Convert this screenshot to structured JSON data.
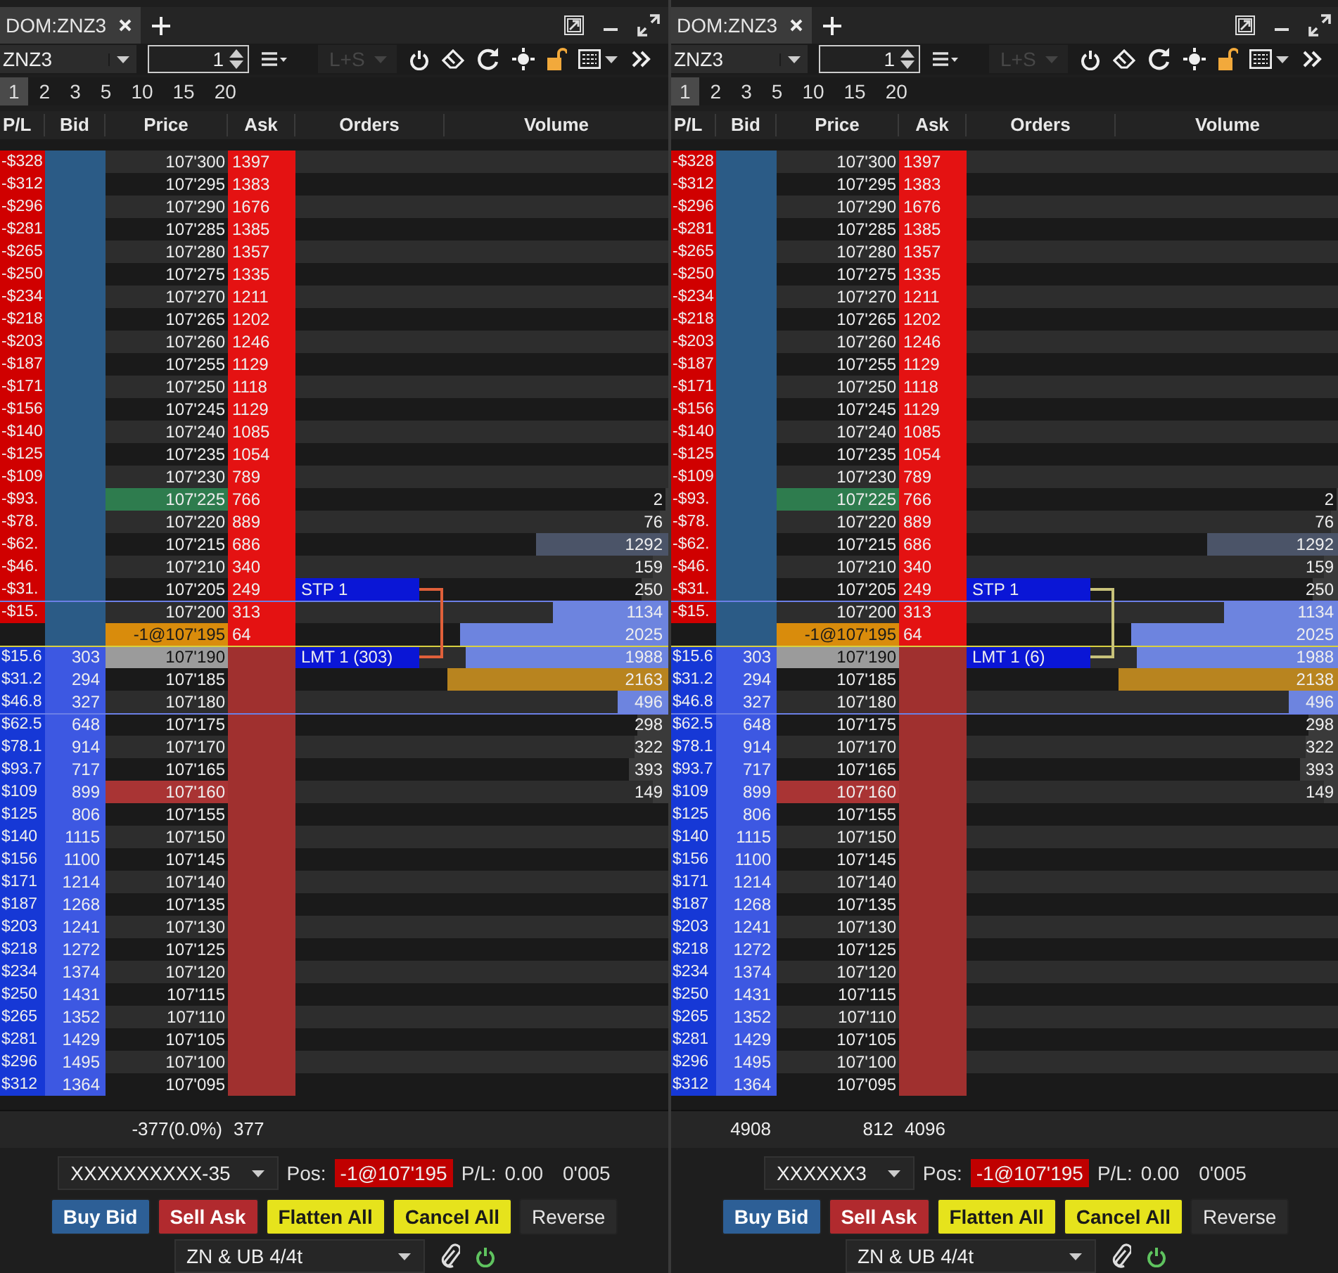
{
  "panels": [
    {
      "tab": {
        "label": "DOM:ZNZ3"
      },
      "toolbar": {
        "symbol": "ZNZ3",
        "quantity": "1",
        "mode": {
          "label": "L+S",
          "disabled": true
        }
      },
      "presets": [
        {
          "label": "1",
          "selected": true
        },
        {
          "label": "2",
          "selected": false
        },
        {
          "label": "3",
          "selected": false
        },
        {
          "label": "5",
          "selected": false
        },
        {
          "label": "10",
          "selected": false
        },
        {
          "label": "15",
          "selected": false
        },
        {
          "label": "20",
          "selected": false
        }
      ],
      "columns": [
        "P/L",
        "Bid",
        "Price",
        "Ask",
        "Orders",
        "Volume"
      ],
      "bracket": {
        "color": "#e0603a"
      },
      "rows": [
        {
          "pl": "-$328",
          "price": "107'300",
          "ask": "1397",
          "kind": "plain"
        },
        {
          "pl": "-$312",
          "price": "107'295",
          "ask": "1383",
          "kind": "plain"
        },
        {
          "pl": "-$296",
          "price": "107'290",
          "ask": "1676",
          "kind": "plain"
        },
        {
          "pl": "-$281",
          "price": "107'285",
          "ask": "1385",
          "kind": "plain"
        },
        {
          "pl": "-$265",
          "price": "107'280",
          "ask": "1357",
          "kind": "plain"
        },
        {
          "pl": "-$250",
          "price": "107'275",
          "ask": "1335",
          "kind": "plain"
        },
        {
          "pl": "-$234",
          "price": "107'270",
          "ask": "1211",
          "kind": "plain"
        },
        {
          "pl": "-$218",
          "price": "107'265",
          "ask": "1202",
          "kind": "plain"
        },
        {
          "pl": "-$203",
          "price": "107'260",
          "ask": "1246",
          "kind": "plain"
        },
        {
          "pl": "-$187",
          "price": "107'255",
          "ask": "1129",
          "kind": "plain"
        },
        {
          "pl": "-$171",
          "price": "107'250",
          "ask": "1118",
          "kind": "plain"
        },
        {
          "pl": "-$156",
          "price": "107'245",
          "ask": "1129",
          "kind": "plain"
        },
        {
          "pl": "-$140",
          "price": "107'240",
          "ask": "1085",
          "kind": "plain"
        },
        {
          "pl": "-$125",
          "price": "107'235",
          "ask": "1054",
          "kind": "plain"
        },
        {
          "pl": "-$109",
          "price": "107'230",
          "ask": "789",
          "kind": "plain"
        },
        {
          "pl": "-$93.",
          "price": "107'225",
          "ask": "766",
          "kind": "high",
          "volume": {
            "value": "2",
            "level": 0.01,
            "kind": "plain"
          }
        },
        {
          "pl": "-$78.",
          "price": "107'220",
          "ask": "889",
          "kind": "plain",
          "volume": {
            "value": "76",
            "level": 0.04,
            "kind": "plain"
          }
        },
        {
          "pl": "-$62.",
          "price": "107'215",
          "ask": "686",
          "kind": "plain",
          "volume": {
            "value": "1292",
            "level": 0.6,
            "kind": "slate"
          }
        },
        {
          "pl": "-$46.",
          "price": "107'210",
          "ask": "340",
          "kind": "plain",
          "volume": {
            "value": "159",
            "level": 0.07,
            "kind": "plain"
          }
        },
        {
          "pl": "-$31.",
          "price": "107'205",
          "ask": "249",
          "kind": "plain",
          "volume": {
            "value": "250",
            "level": 0.12,
            "kind": "plain"
          },
          "order": "STP 1"
        },
        {
          "pl": "-$15.",
          "price": "107'200",
          "ask": "313",
          "kind": "plain",
          "volume": {
            "value": "1134",
            "level": 0.52,
            "kind": "blue"
          },
          "rule": {
            "kind": "range"
          }
        },
        {
          "price": "-1@107'195",
          "ask": "64",
          "kind": "position",
          "volume": {
            "value": "2025",
            "level": 0.94,
            "kind": "blue"
          }
        },
        {
          "pl": "$15.6",
          "bid": "303",
          "price": "107'190",
          "kind": "current",
          "volume": {
            "value": "1988",
            "level": 0.92,
            "kind": "blue"
          },
          "order": "LMT 1 (303)",
          "rule": {
            "kind": "inside"
          }
        },
        {
          "pl": "$31.2",
          "bid": "294",
          "price": "107'185",
          "kind": "plain",
          "volume": {
            "value": "2163",
            "level": 1,
            "kind": "gold"
          }
        },
        {
          "pl": "$46.8",
          "bid": "327",
          "price": "107'180",
          "kind": "plain",
          "volume": {
            "value": "496",
            "level": 0.23,
            "kind": "blue"
          }
        },
        {
          "pl": "$62.5",
          "bid": "648",
          "price": "107'175",
          "kind": "plain",
          "volume": {
            "value": "298",
            "level": 0.14,
            "kind": "plain"
          },
          "rule": {
            "kind": "range"
          }
        },
        {
          "pl": "$78.1",
          "bid": "914",
          "price": "107'170",
          "kind": "plain",
          "volume": {
            "value": "322",
            "level": 0.15,
            "kind": "plain"
          }
        },
        {
          "pl": "$93.7",
          "bid": "717",
          "price": "107'165",
          "kind": "plain",
          "volume": {
            "value": "393",
            "level": 0.18,
            "kind": "plain"
          }
        },
        {
          "pl": "$109",
          "bid": "899",
          "price": "107'160",
          "kind": "low",
          "volume": {
            "value": "149",
            "level": 0.07,
            "kind": "plain"
          }
        },
        {
          "pl": "$125",
          "bid": "806",
          "price": "107'155",
          "kind": "plain"
        },
        {
          "pl": "$140",
          "bid": "1115",
          "price": "107'150",
          "kind": "plain"
        },
        {
          "pl": "$156",
          "bid": "1100",
          "price": "107'145",
          "kind": "plain"
        },
        {
          "pl": "$171",
          "bid": "1214",
          "price": "107'140",
          "kind": "plain"
        },
        {
          "pl": "$187",
          "bid": "1268",
          "price": "107'135",
          "kind": "plain"
        },
        {
          "pl": "$203",
          "bid": "1241",
          "price": "107'130",
          "kind": "plain"
        },
        {
          "pl": "$218",
          "bid": "1272",
          "price": "107'125",
          "kind": "plain"
        },
        {
          "pl": "$234",
          "bid": "1374",
          "price": "107'120",
          "kind": "plain"
        },
        {
          "pl": "$250",
          "bid": "1431",
          "price": "107'115",
          "kind": "plain"
        },
        {
          "pl": "$265",
          "bid": "1352",
          "price": "107'110",
          "kind": "plain"
        },
        {
          "pl": "$281",
          "bid": "1429",
          "price": "107'105",
          "kind": "plain"
        },
        {
          "pl": "$296",
          "bid": "1495",
          "price": "107'100",
          "kind": "plain"
        },
        {
          "pl": "$312",
          "bid": "1364",
          "price": "107'095",
          "kind": "plain"
        }
      ],
      "summary": {
        "price": "-377(0.0%)",
        "ask": "377"
      },
      "account": {
        "name": "XXXXXXXXXX-35",
        "pos_label": "Pos:",
        "position": "-1@107'195",
        "pl_label": "P/L:",
        "pl": "0.00",
        "tick": "0'005"
      },
      "buttons": [
        {
          "label": "Buy Bid",
          "kind": "buy"
        },
        {
          "label": "Sell Ask",
          "kind": "sell"
        },
        {
          "label": "Flatten All",
          "kind": "warn"
        },
        {
          "label": "Cancel All",
          "kind": "warn"
        },
        {
          "label": "Reverse",
          "kind": "plain"
        }
      ],
      "template": {
        "name": "ZN & UB 4/4t",
        "connected": true
      }
    },
    {
      "tab": {
        "label": "DOM:ZNZ3"
      },
      "toolbar": {
        "symbol": "ZNZ3",
        "quantity": "1",
        "mode": {
          "label": "L+S",
          "disabled": true
        }
      },
      "presets": [
        {
          "label": "1",
          "selected": true
        },
        {
          "label": "2",
          "selected": false
        },
        {
          "label": "3",
          "selected": false
        },
        {
          "label": "5",
          "selected": false
        },
        {
          "label": "10",
          "selected": false
        },
        {
          "label": "15",
          "selected": false
        },
        {
          "label": "20",
          "selected": false
        }
      ],
      "columns": [
        "P/L",
        "Bid",
        "Price",
        "Ask",
        "Orders",
        "Volume"
      ],
      "bracket": {
        "color": "#c8c27a"
      },
      "rows": [
        {
          "pl": "-$328",
          "price": "107'300",
          "ask": "1397",
          "kind": "plain"
        },
        {
          "pl": "-$312",
          "price": "107'295",
          "ask": "1383",
          "kind": "plain"
        },
        {
          "pl": "-$296",
          "price": "107'290",
          "ask": "1676",
          "kind": "plain"
        },
        {
          "pl": "-$281",
          "price": "107'285",
          "ask": "1385",
          "kind": "plain"
        },
        {
          "pl": "-$265",
          "price": "107'280",
          "ask": "1357",
          "kind": "plain"
        },
        {
          "pl": "-$250",
          "price": "107'275",
          "ask": "1335",
          "kind": "plain"
        },
        {
          "pl": "-$234",
          "price": "107'270",
          "ask": "1211",
          "kind": "plain"
        },
        {
          "pl": "-$218",
          "price": "107'265",
          "ask": "1202",
          "kind": "plain"
        },
        {
          "pl": "-$203",
          "price": "107'260",
          "ask": "1246",
          "kind": "plain"
        },
        {
          "pl": "-$187",
          "price": "107'255",
          "ask": "1129",
          "kind": "plain"
        },
        {
          "pl": "-$171",
          "price": "107'250",
          "ask": "1118",
          "kind": "plain"
        },
        {
          "pl": "-$156",
          "price": "107'245",
          "ask": "1129",
          "kind": "plain"
        },
        {
          "pl": "-$140",
          "price": "107'240",
          "ask": "1085",
          "kind": "plain"
        },
        {
          "pl": "-$125",
          "price": "107'235",
          "ask": "1054",
          "kind": "plain"
        },
        {
          "pl": "-$109",
          "price": "107'230",
          "ask": "789",
          "kind": "plain"
        },
        {
          "pl": "-$93.",
          "price": "107'225",
          "ask": "766",
          "kind": "high",
          "volume": {
            "value": "2",
            "level": 0.01,
            "kind": "plain"
          }
        },
        {
          "pl": "-$78.",
          "price": "107'220",
          "ask": "889",
          "kind": "plain",
          "volume": {
            "value": "76",
            "level": 0.04,
            "kind": "plain"
          }
        },
        {
          "pl": "-$62.",
          "price": "107'215",
          "ask": "686",
          "kind": "plain",
          "volume": {
            "value": "1292",
            "level": 0.6,
            "kind": "slate"
          }
        },
        {
          "pl": "-$46.",
          "price": "107'210",
          "ask": "340",
          "kind": "plain",
          "volume": {
            "value": "159",
            "level": 0.07,
            "kind": "plain"
          }
        },
        {
          "pl": "-$31.",
          "price": "107'205",
          "ask": "249",
          "kind": "plain",
          "volume": {
            "value": "250",
            "level": 0.12,
            "kind": "plain"
          },
          "order": "STP 1"
        },
        {
          "pl": "-$15.",
          "price": "107'200",
          "ask": "313",
          "kind": "plain",
          "volume": {
            "value": "1134",
            "level": 0.52,
            "kind": "blue"
          },
          "rule": {
            "kind": "range"
          }
        },
        {
          "price": "-1@107'195",
          "ask": "64",
          "kind": "position",
          "volume": {
            "value": "2025",
            "level": 0.94,
            "kind": "blue"
          }
        },
        {
          "pl": "$15.6",
          "bid": "303",
          "price": "107'190",
          "kind": "current",
          "volume": {
            "value": "1988",
            "level": 0.92,
            "kind": "blue"
          },
          "order": "LMT 1 (6)",
          "rule": {
            "kind": "inside"
          }
        },
        {
          "pl": "$31.2",
          "bid": "294",
          "price": "107'185",
          "kind": "plain",
          "volume": {
            "value": "2138",
            "level": 1,
            "kind": "gold"
          }
        },
        {
          "pl": "$46.8",
          "bid": "327",
          "price": "107'180",
          "kind": "plain",
          "volume": {
            "value": "496",
            "level": 0.23,
            "kind": "blue"
          }
        },
        {
          "pl": "$62.5",
          "bid": "648",
          "price": "107'175",
          "kind": "plain",
          "volume": {
            "value": "298",
            "level": 0.14,
            "kind": "plain"
          },
          "rule": {
            "kind": "range"
          }
        },
        {
          "pl": "$78.1",
          "bid": "914",
          "price": "107'170",
          "kind": "plain",
          "volume": {
            "value": "322",
            "level": 0.15,
            "kind": "plain"
          }
        },
        {
          "pl": "$93.7",
          "bid": "717",
          "price": "107'165",
          "kind": "plain",
          "volume": {
            "value": "393",
            "level": 0.18,
            "kind": "plain"
          }
        },
        {
          "pl": "$109",
          "bid": "899",
          "price": "107'160",
          "kind": "low",
          "volume": {
            "value": "149",
            "level": 0.07,
            "kind": "plain"
          }
        },
        {
          "pl": "$125",
          "bid": "806",
          "price": "107'155",
          "kind": "plain"
        },
        {
          "pl": "$140",
          "bid": "1115",
          "price": "107'150",
          "kind": "plain"
        },
        {
          "pl": "$156",
          "bid": "1100",
          "price": "107'145",
          "kind": "plain"
        },
        {
          "pl": "$171",
          "bid": "1214",
          "price": "107'140",
          "kind": "plain"
        },
        {
          "pl": "$187",
          "bid": "1268",
          "price": "107'135",
          "kind": "plain"
        },
        {
          "pl": "$203",
          "bid": "1241",
          "price": "107'130",
          "kind": "plain"
        },
        {
          "pl": "$218",
          "bid": "1272",
          "price": "107'125",
          "kind": "plain"
        },
        {
          "pl": "$234",
          "bid": "1374",
          "price": "107'120",
          "kind": "plain"
        },
        {
          "pl": "$250",
          "bid": "1431",
          "price": "107'115",
          "kind": "plain"
        },
        {
          "pl": "$265",
          "bid": "1352",
          "price": "107'110",
          "kind": "plain"
        },
        {
          "pl": "$281",
          "bid": "1429",
          "price": "107'105",
          "kind": "plain"
        },
        {
          "pl": "$296",
          "bid": "1495",
          "price": "107'100",
          "kind": "plain"
        },
        {
          "pl": "$312",
          "bid": "1364",
          "price": "107'095",
          "kind": "plain"
        }
      ],
      "summary": {
        "bid": "4908",
        "price": "812",
        "ask": "4096"
      },
      "account": {
        "name": "XXXXXX3",
        "pos_label": "Pos:",
        "position": "-1@107'195",
        "pl_label": "P/L:",
        "pl": "0.00",
        "tick": "0'005"
      },
      "buttons": [
        {
          "label": "Buy Bid",
          "kind": "buy"
        },
        {
          "label": "Sell Ask",
          "kind": "sell"
        },
        {
          "label": "Flatten All",
          "kind": "warn"
        },
        {
          "label": "Cancel All",
          "kind": "warn"
        },
        {
          "label": "Reverse",
          "kind": "plain"
        }
      ],
      "template": {
        "name": "ZN & UB 4/4t",
        "connected": true
      }
    }
  ]
}
